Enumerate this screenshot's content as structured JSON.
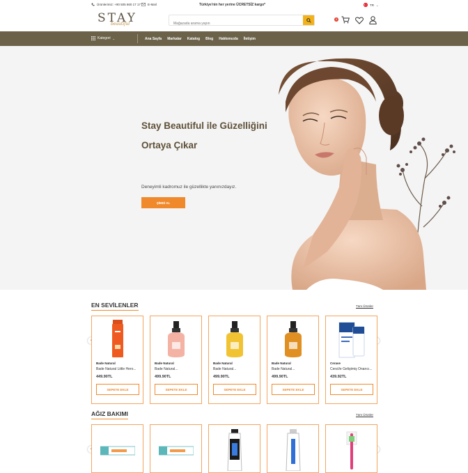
{
  "topbar": {
    "phone": "Ürünlerimiz: +90 505 660 17 17",
    "email": "E-Mail",
    "shipping": "Türkiye'nin her yerine ÜCRETSİZ kargo*",
    "lang": "TR"
  },
  "header": {
    "logo_main": "STAY",
    "logo_sub": "beautiful",
    "search_placeholder": "Mağazada arama yapın",
    "cart_count": "0"
  },
  "nav": {
    "category_label": "Kategori",
    "links": [
      "Ana Sayfa",
      "Markalar",
      "Katalog",
      "Blog",
      "Hakkımızda",
      "İletişim"
    ]
  },
  "hero": {
    "title": "Stay Beautiful ile Güzelliğini Ortaya Çıkar",
    "subtitle": "Deneyimli kadromuz ile güzellikte yanınızdayız.",
    "button": "ŞİMDİ AL"
  },
  "section1": {
    "title": "EN SEVİLENLER",
    "all_link": "Tüm Ürünler",
    "products": [
      {
        "brand": "Bade Natural",
        "name": "Bade Natural Little Hero...",
        "price": "449.90TL",
        "add": "SEPETE EKLE"
      },
      {
        "brand": "Bade Natural",
        "name": "Bade Natural...",
        "price": "499.90TL",
        "add": "SEPETE EKLE"
      },
      {
        "brand": "Bade Natural",
        "name": "Bade Natural...",
        "price": "499.90TL",
        "add": "SEPETE EKLE"
      },
      {
        "brand": "Bade Natural",
        "name": "Bade Natural...",
        "price": "499.90TL",
        "add": "SEPETE EKLE"
      },
      {
        "brand": "Cerave",
        "name": "CeraVe Geliştmiş Onarıcı...",
        "price": "439.92TL",
        "add": "SEPETE EKLE"
      }
    ]
  },
  "section2": {
    "title": "AĞIZ BAKIMI",
    "all_link": "Tüm Ürünler"
  },
  "colors": {
    "accent": "#f0892b",
    "nav": "#6b6249",
    "title": "#5e5038",
    "search_btn": "#f3b21a"
  }
}
